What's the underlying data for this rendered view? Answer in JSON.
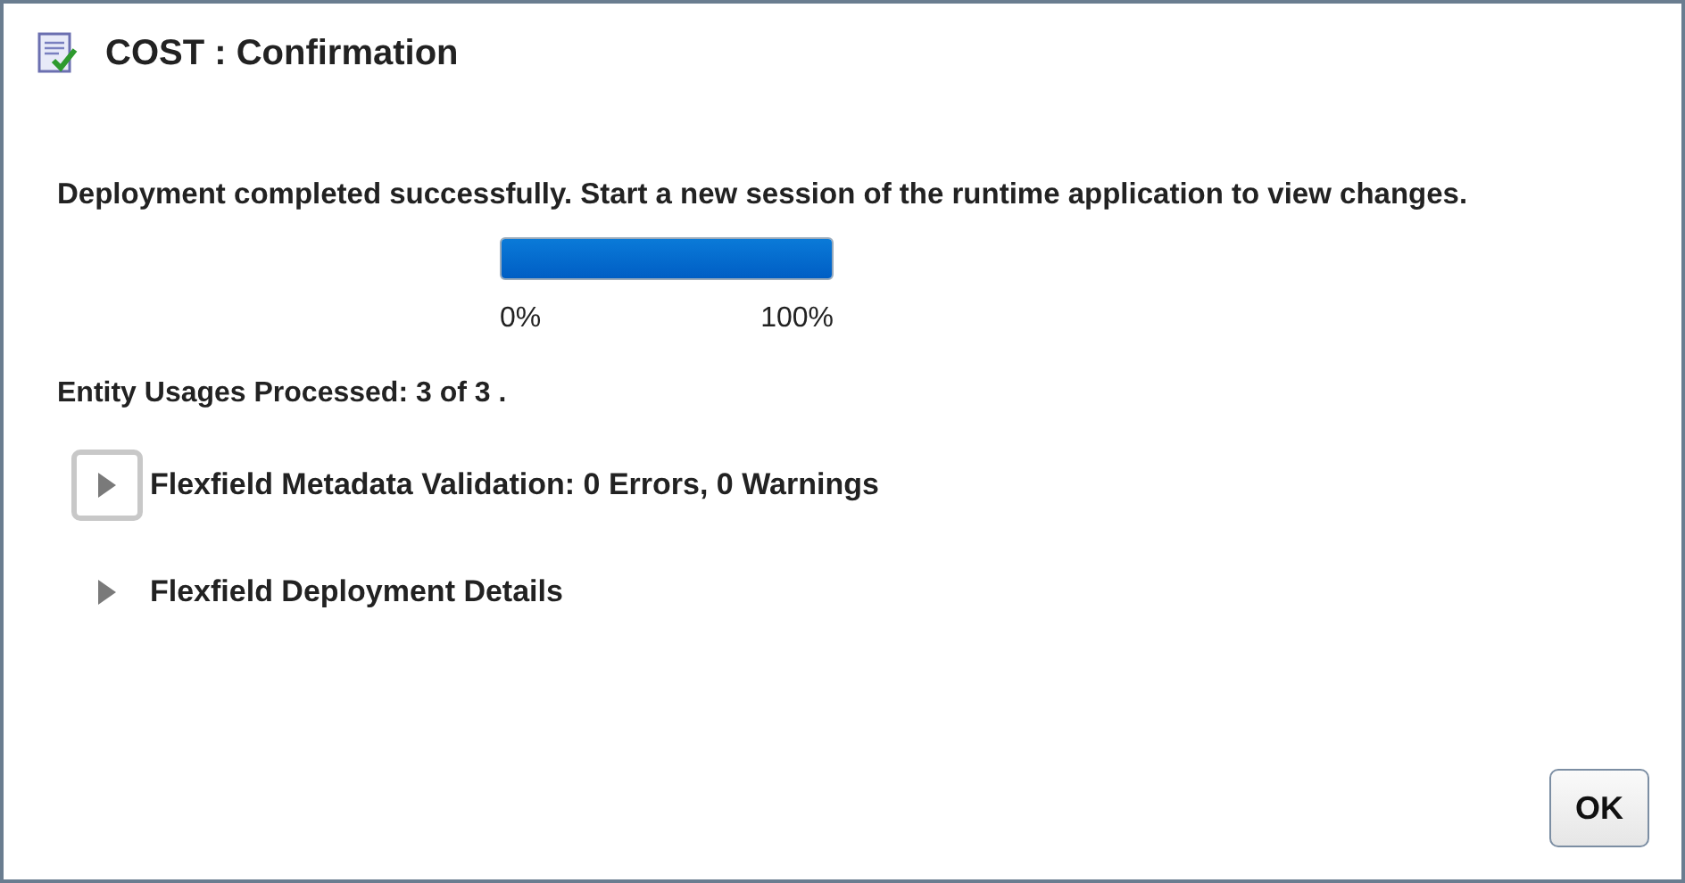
{
  "window": {
    "title": "COST : Confirmation"
  },
  "message": "Deployment completed successfully. Start a new session of the runtime application to view changes.",
  "progress": {
    "level": 1,
    "min_label": "0%",
    "max_label": "100%"
  },
  "status": "Entity Usages Processed: 3 of 3 .",
  "sections": [
    {
      "label": "Flexfield Metadata Validation: 0 Errors, 0 Warnings",
      "expanded": false,
      "focused": true
    },
    {
      "label": "Flexfield Deployment Details",
      "expanded": false,
      "focused": false
    }
  ],
  "buttons": [
    "OK"
  ]
}
